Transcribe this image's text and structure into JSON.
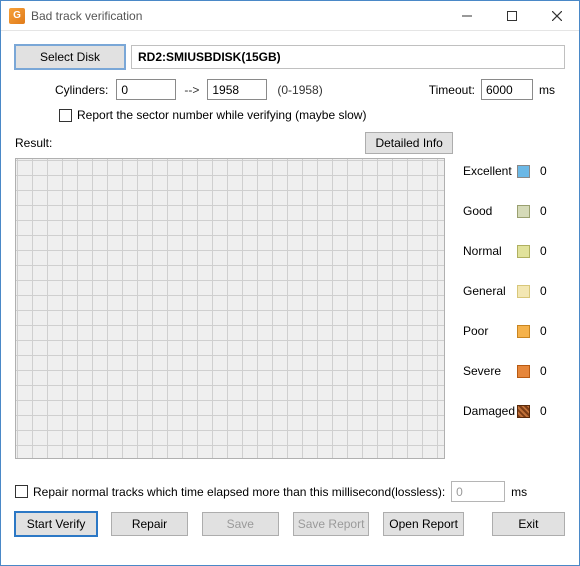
{
  "window": {
    "title": "Bad track verification"
  },
  "disk": {
    "select_label": "Select Disk",
    "name": "RD2:SMIUSBDISK(15GB)"
  },
  "cylinders": {
    "label": "Cylinders:",
    "from": "0",
    "arrow": "-->",
    "to": "1958",
    "range": "(0-1958)"
  },
  "timeout": {
    "label": "Timeout:",
    "value": "6000",
    "unit": "ms"
  },
  "report_sector": {
    "label": "Report the sector number while verifying (maybe slow)",
    "checked": false
  },
  "result": {
    "label": "Result:",
    "detailed_label": "Detailed Info"
  },
  "legend": {
    "items": [
      {
        "name": "Excellent",
        "count": "0",
        "swatch": "sw-excellent"
      },
      {
        "name": "Good",
        "count": "0",
        "swatch": "sw-good"
      },
      {
        "name": "Normal",
        "count": "0",
        "swatch": "sw-normal"
      },
      {
        "name": "General",
        "count": "0",
        "swatch": "sw-general"
      },
      {
        "name": "Poor",
        "count": "0",
        "swatch": "sw-poor"
      },
      {
        "name": "Severe",
        "count": "0",
        "swatch": "sw-severe"
      },
      {
        "name": "Damaged",
        "count": "0",
        "swatch": "sw-damaged"
      }
    ]
  },
  "repair": {
    "label": "Repair normal tracks which time elapsed more than this millisecond(lossless):",
    "value": "0",
    "unit": "ms",
    "checked": false
  },
  "buttons": {
    "start_verify": "Start Verify",
    "repair": "Repair",
    "save": "Save",
    "save_report": "Save Report",
    "open_report": "Open Report",
    "exit": "Exit"
  }
}
